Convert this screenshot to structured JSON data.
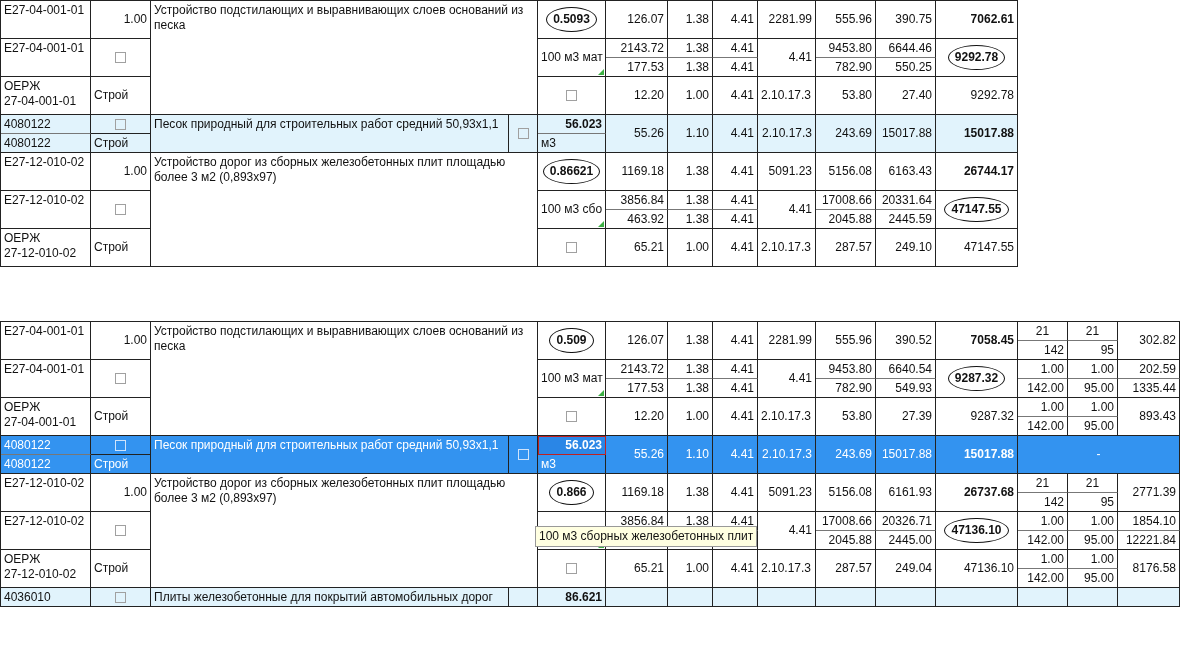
{
  "tables": [
    {
      "blocks": [
        {
          "kind": "work",
          "code": "E27-04-001-01",
          "qty": "1.00",
          "code2": "E27-04-001-01",
          "flag_checked": false,
          "code3": "ОЕРЖ 27-04-001-01",
          "source": "Строй",
          "name": "Устройство подстилающих и выравнивающих слоев оснований из песка",
          "amount": "0.5093",
          "amount_circled": true,
          "unit": "100 м3 мат",
          "unit_note": true,
          "amount_flag_checked": false,
          "prices": [
            [
              "126.07",
              "1.38",
              "4.41"
            ],
            [
              "2143.72",
              "1.38",
              "4.41"
            ],
            [
              "177.53",
              "1.38",
              "4.41"
            ],
            [
              "12.20",
              "1.00",
              "4.41"
            ]
          ],
          "refs": [
            "2281.99",
            "4.41",
            "2.10.17.3"
          ],
          "costs": [
            [
              "555.96",
              "390.75"
            ],
            [
              "9453.80",
              "6644.46"
            ],
            [
              "782.90",
              "550.25"
            ],
            [
              "53.80",
              "27.40"
            ]
          ],
          "totals": [
            {
              "text": "7062.61",
              "bold": true,
              "circled": false
            },
            {
              "text": "9292.78",
              "bold": true,
              "circled": true
            },
            {
              "text": "9292.78",
              "bold": false,
              "circled": false
            }
          ]
        },
        {
          "kind": "material",
          "selected": false,
          "code": "4080122",
          "flag_checked": false,
          "code2": "4080122",
          "source": "Строй",
          "name": "Песок природный для строительных работ средний 50,93х1,1",
          "name_flag_checked": false,
          "amount": "56.023",
          "amount_focused": false,
          "unit": "м3",
          "values": [
            "55.26",
            "1.10",
            "4.41",
            "2.10.17.3",
            "243.69",
            "15017.88"
          ],
          "total": "15017.88"
        },
        {
          "kind": "work",
          "code": "E27-12-010-02",
          "qty": "1.00",
          "code2": "E27-12-010-02",
          "flag_checked": false,
          "code3": "ОЕРЖ 27-12-010-02",
          "source": "Строй",
          "name": "Устройство дорог из сборных железобетонных плит площадью более 3 м2 (0,893х97)",
          "amount": "0.86621",
          "amount_circled": true,
          "unit": "100 м3 сбо",
          "unit_note": true,
          "amount_flag_checked": false,
          "prices": [
            [
              "1169.18",
              "1.38",
              "4.41"
            ],
            [
              "3856.84",
              "1.38",
              "4.41"
            ],
            [
              "463.92",
              "1.38",
              "4.41"
            ],
            [
              "65.21",
              "1.00",
              "4.41"
            ]
          ],
          "refs": [
            "5091.23",
            "4.41",
            "2.10.17.3"
          ],
          "costs": [
            [
              "5156.08",
              "6163.43"
            ],
            [
              "17008.66",
              "20331.64"
            ],
            [
              "2045.88",
              "2445.59"
            ],
            [
              "287.57",
              "249.10"
            ]
          ],
          "totals": [
            {
              "text": "26744.17",
              "bold": true,
              "circled": false
            },
            {
              "text": "47147.55",
              "bold": true,
              "circled": true
            },
            {
              "text": "47147.55",
              "bold": false,
              "circled": false
            }
          ]
        }
      ]
    },
    {
      "blocks": [
        {
          "kind": "work",
          "code": "E27-04-001-01",
          "qty": "1.00",
          "code2": "E27-04-001-01",
          "flag_checked": false,
          "code3": "ОЕРЖ 27-04-001-01",
          "source": "Строй",
          "name": "Устройство подстилающих и выравнивающих слоев оснований из песка",
          "amount": "0.509",
          "amount_circled": true,
          "unit": "100 м3 мат",
          "unit_note": true,
          "amount_flag_checked": false,
          "prices": [
            [
              "126.07",
              "1.38",
              "4.41"
            ],
            [
              "2143.72",
              "1.38",
              "4.41"
            ],
            [
              "177.53",
              "1.38",
              "4.41"
            ],
            [
              "12.20",
              "1.00",
              "4.41"
            ]
          ],
          "refs": [
            "2281.99",
            "4.41",
            "2.10.17.3"
          ],
          "costs": [
            [
              "555.96",
              "390.52"
            ],
            [
              "9453.80",
              "6640.54"
            ],
            [
              "782.90",
              "549.93"
            ],
            [
              "53.80",
              "27.39"
            ]
          ],
          "totals": [
            {
              "text": "7058.45",
              "bold": true,
              "circled": false
            },
            {
              "text": "9287.32",
              "bold": true,
              "circled": true
            },
            {
              "text": "9287.32",
              "bold": false,
              "circled": false
            }
          ],
          "extra": [
            [
              [
                "21",
                "21"
              ],
              [
                "142",
                "95"
              ]
            ],
            [
              [
                "1.00",
                "1.00"
              ],
              [
                "142.00",
                "95.00"
              ]
            ],
            [
              [
                "1.00",
                "1.00"
              ],
              [
                "142.00",
                "95.00"
              ]
            ]
          ],
          "sums": [
            "302.82",
            "202.59",
            "1335.44",
            "893.43"
          ]
        },
        {
          "kind": "material",
          "selected": true,
          "code": "4080122",
          "flag_checked": false,
          "code2": "4080122",
          "source": "Строй",
          "name": "Песок природный для строительных работ средний 50,93х1,1",
          "name_flag_checked": false,
          "amount": "56.023",
          "amount_focused": true,
          "unit": "м3",
          "values": [
            "55.26",
            "1.10",
            "4.41",
            "2.10.17.3",
            "243.69",
            "15017.88"
          ],
          "total": "15017.88",
          "extra": "-"
        },
        {
          "kind": "work",
          "code": "E27-12-010-02",
          "qty": "1.00",
          "code2": "E27-12-010-02",
          "flag_checked": false,
          "code3": "ОЕРЖ 27-12-010-02",
          "source": "Строй",
          "name": "Устройство дорог из сборных железобетонных плит площадью более 3 м2 (0,893х97)",
          "amount": "0.866",
          "amount_circled": true,
          "unit_tooltip": "100 м3 сборных железобетонных плит",
          "unit_note": true,
          "amount_flag_checked": false,
          "prices": [
            [
              "1169.18",
              "1.38",
              "4.41"
            ],
            [
              "3856.84",
              "1.38",
              "4.41"
            ],
            {
              "kind": "covered"
            },
            [
              "65.21",
              "1.00",
              "4.41"
            ]
          ],
          "refs": [
            "5091.23",
            "4.41",
            "2.10.17.3"
          ],
          "costs": [
            [
              "5156.08",
              "6161.93"
            ],
            [
              "17008.66",
              "20326.71"
            ],
            [
              "2045.88",
              "2445.00"
            ],
            [
              "287.57",
              "249.04"
            ]
          ],
          "totals": [
            {
              "text": "26737.68",
              "bold": true,
              "circled": false
            },
            {
              "text": "47136.10",
              "bold": true,
              "circled": true
            },
            {
              "text": "47136.10",
              "bold": false,
              "circled": false
            }
          ],
          "extra": [
            [
              [
                "21",
                "21"
              ],
              [
                "142",
                "95"
              ]
            ],
            [
              [
                "1.00",
                "1.00"
              ],
              [
                "142.00",
                "95.00"
              ]
            ],
            [
              [
                "1.00",
                "1.00"
              ],
              [
                "142.00",
                "95.00"
              ]
            ]
          ],
          "sums": [
            "2771.39",
            "1854.10",
            "12221.84",
            "8176.58"
          ]
        },
        {
          "kind": "partial",
          "code": "4036010",
          "flag_checked": false,
          "name": "Плиты железобетонные для покрытий автомобильных дорог",
          "amount": "86.621"
        }
      ]
    }
  ]
}
